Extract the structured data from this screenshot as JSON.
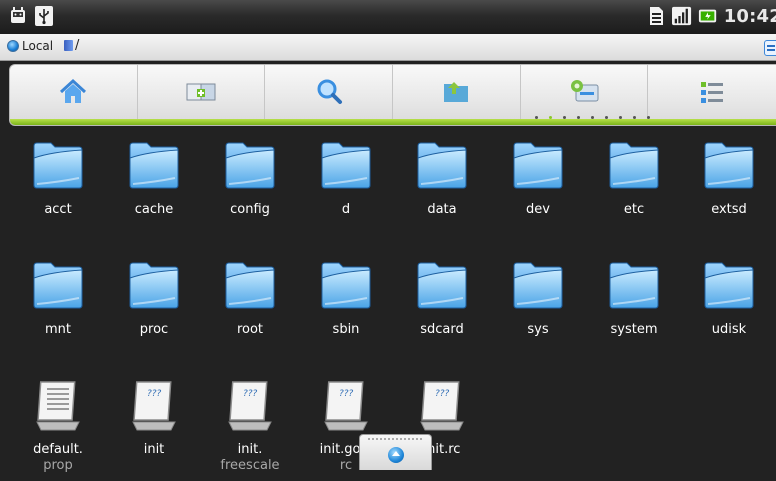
{
  "status_bar": {
    "left_icons": [
      "android-icon",
      "usb-icon"
    ],
    "right_icons": [
      "sd-card-icon",
      "signal-icon",
      "battery-charging-icon"
    ],
    "time": "10:42"
  },
  "path_bar": {
    "location_label": "Local",
    "path": "/"
  },
  "toolbar": {
    "buttons": [
      {
        "icon": "home-icon"
      },
      {
        "icon": "new-folder-icon"
      },
      {
        "icon": "search-icon"
      },
      {
        "icon": "folder-up-icon"
      },
      {
        "icon": "settings-icon"
      },
      {
        "icon": "list-view-icon"
      }
    ],
    "page_indicator": {
      "count": 9,
      "active": 1
    },
    "accent_color": "#8bc82a"
  },
  "files": [
    {
      "name": "acct",
      "type": "folder"
    },
    {
      "name": "cache",
      "type": "folder"
    },
    {
      "name": "config",
      "type": "folder"
    },
    {
      "name": "d",
      "type": "folder"
    },
    {
      "name": "data",
      "type": "folder"
    },
    {
      "name": "dev",
      "type": "folder"
    },
    {
      "name": "etc",
      "type": "folder"
    },
    {
      "name": "extsd",
      "type": "folder"
    },
    {
      "name": "mnt",
      "type": "folder"
    },
    {
      "name": "proc",
      "type": "folder"
    },
    {
      "name": "root",
      "type": "folder"
    },
    {
      "name": "sbin",
      "type": "folder"
    },
    {
      "name": "sdcard",
      "type": "folder"
    },
    {
      "name": "sys",
      "type": "folder"
    },
    {
      "name": "system",
      "type": "folder"
    },
    {
      "name": "udisk",
      "type": "folder"
    },
    {
      "name": "default.",
      "name2": "prop",
      "type": "document"
    },
    {
      "name": "init",
      "type": "script"
    },
    {
      "name": "init.",
      "name2": "freescale",
      "type": "script"
    },
    {
      "name": "init.gold",
      "name2": "rc",
      "type": "script"
    },
    {
      "name": "init.rc",
      "type": "script"
    }
  ],
  "drawer_handle": {
    "icon": "chevron-up-icon"
  }
}
